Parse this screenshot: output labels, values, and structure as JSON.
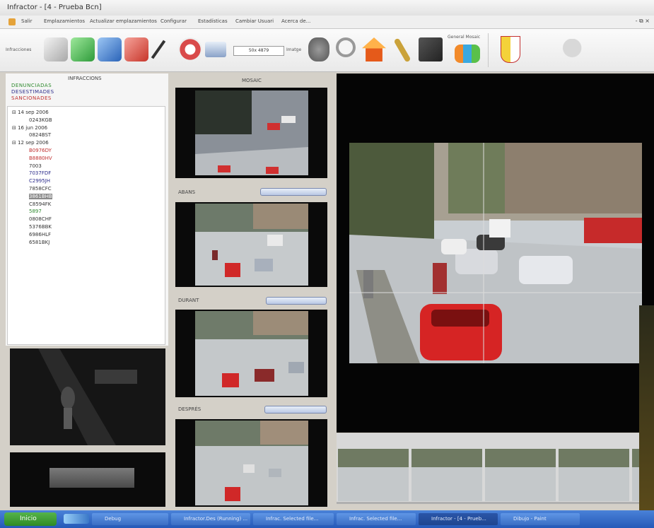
{
  "window": {
    "title": "Infractor - [4 - Prueba Bcn]"
  },
  "menu": {
    "items": [
      "Salir",
      "Emplazamientos",
      "Actualizar emplazamientos",
      "Configurar",
      "Estadísticas",
      "Cambiar Usuari",
      "Acerca de..."
    ],
    "controls": "- ⧉ ×"
  },
  "toolbar": {
    "label_left": "Infracciones",
    "zoom_value": "50x 4879",
    "label_image": "Imatge",
    "label_general": "General Mosaic"
  },
  "left": {
    "title": "INFRACCIONS",
    "legend": [
      {
        "text": "DENUNCIADAS",
        "color": "#2e8a2e"
      },
      {
        "text": "DESESTIMADES",
        "color": "#2a2a8a"
      },
      {
        "text": "SANCIONADES",
        "color": "#c03030"
      }
    ],
    "tree": [
      {
        "text": "⊟ 14 sep 2006",
        "indent": 0,
        "color": "#333",
        "sel": false
      },
      {
        "text": "0243KGB",
        "indent": 2,
        "color": "#333",
        "sel": false
      },
      {
        "text": "⊟ 16 jun 2006",
        "indent": 0,
        "color": "#333",
        "sel": false
      },
      {
        "text": "0824BST",
        "indent": 2,
        "color": "#333",
        "sel": false
      },
      {
        "text": "⊟ 12 sep 2006",
        "indent": 0,
        "color": "#333",
        "sel": false
      },
      {
        "text": "B0976DY",
        "indent": 2,
        "color": "#c03030",
        "sel": false
      },
      {
        "text": "B8880HV",
        "indent": 2,
        "color": "#c03030",
        "sel": false
      },
      {
        "text": "7003",
        "indent": 2,
        "color": "#333",
        "sel": false
      },
      {
        "text": "7037FDF",
        "indent": 2,
        "color": "#2a2a8a",
        "sel": false
      },
      {
        "text": "C2995JH",
        "indent": 2,
        "color": "#2a2a8a",
        "sel": false
      },
      {
        "text": "7858CFC",
        "indent": 2,
        "color": "#333",
        "sel": false
      },
      {
        "text": "3861BHB",
        "indent": 2,
        "color": "#fff",
        "sel": true
      },
      {
        "text": "C8594FK",
        "indent": 2,
        "color": "#333",
        "sel": false
      },
      {
        "text": "5897",
        "indent": 2,
        "color": "#2e8a2e",
        "sel": false
      },
      {
        "text": "0808CHF",
        "indent": 2,
        "color": "#333",
        "sel": false
      },
      {
        "text": "5376BBK",
        "indent": 2,
        "color": "#333",
        "sel": false
      },
      {
        "text": "6986HLF",
        "indent": 2,
        "color": "#333",
        "sel": false
      },
      {
        "text": "6581BKJ",
        "indent": 2,
        "color": "#333",
        "sel": false
      }
    ]
  },
  "middle": {
    "header": "MOSAIC",
    "sections": [
      {
        "label": "ABANS"
      },
      {
        "label": "DURANT"
      },
      {
        "label": "DESPRÉS"
      }
    ]
  },
  "taskbar": {
    "start": "Inicio",
    "tasks": [
      {
        "label": "Debug"
      },
      {
        "label": "Infractor.Des (Running) ..."
      },
      {
        "label": "Infrac. Selected file..."
      },
      {
        "label": "Infrac. Selected file..."
      },
      {
        "label": "Infractor - [4 - Prueb..."
      },
      {
        "label": "Dibujo - Paint"
      }
    ]
  }
}
